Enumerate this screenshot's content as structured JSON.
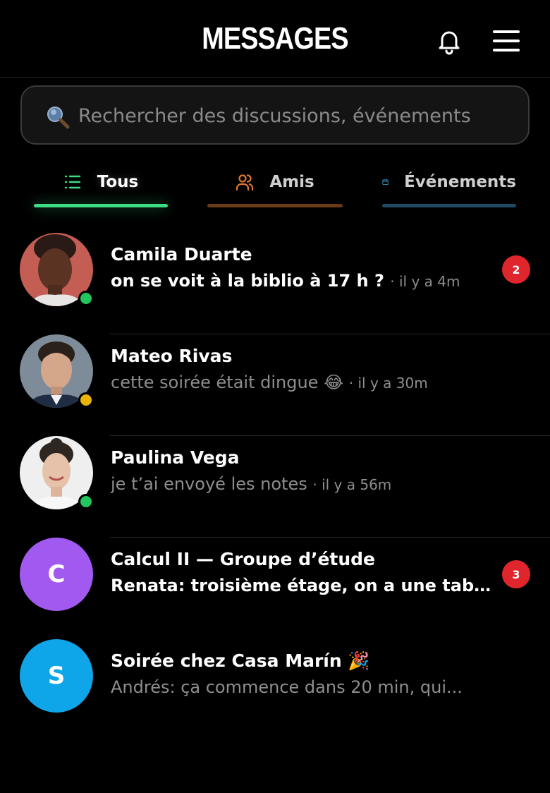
{
  "header": {
    "title": "MESSAGES",
    "bell_icon": "bell-icon",
    "menu_icon": "hamburger-menu-icon"
  },
  "search": {
    "placeholder": "Rechercher des discussions, événements",
    "value": "",
    "icon": "magnifier-icon"
  },
  "tabs": [
    {
      "label": "Tous",
      "icon": "list-icon",
      "active": true,
      "color": "#3ddc84"
    },
    {
      "label": "Amis",
      "icon": "users-icon",
      "active": false,
      "color": "#e0782b"
    },
    {
      "label": "Événements",
      "icon": "calendar-icon",
      "active": false,
      "color": "#3aa8e0"
    }
  ],
  "conversations": [
    {
      "name": "Camila Duarte",
      "preview": "on se voit à la biblio à 17 h ?",
      "time": "· il y a 4m",
      "unread": 2,
      "status": "online",
      "status_color": "#22c55e"
    },
    {
      "name": "Mateo Rivas",
      "preview": "cette soirée était dingue 😂",
      "time": "· il y a 30m",
      "unread": 0,
      "status": "away",
      "status_color": "#eab308"
    },
    {
      "name": "Paulina Vega",
      "preview": "je t’ai envoyé les notes",
      "time": "· il y a 56m",
      "unread": 0,
      "status": "online",
      "status_color": "#22c55e"
    },
    {
      "name": "Calcul II — Groupe d’étude",
      "preview": "Renata: troisième étage, on a une tab...",
      "time": "",
      "unread": 3,
      "avatar_letter": "C",
      "avatar_color": "#a259f0"
    },
    {
      "name": "Soirée chez Casa Marín 🎉",
      "preview": "Andrés: ça commence dans 20 min, qui...",
      "time": "",
      "unread": 0,
      "avatar_letter": "S",
      "avatar_color": "#0ea5e9"
    }
  ],
  "colors": {
    "background": "#000000",
    "badge": "#e0262d",
    "online": "#22c55e",
    "away": "#eab308"
  }
}
